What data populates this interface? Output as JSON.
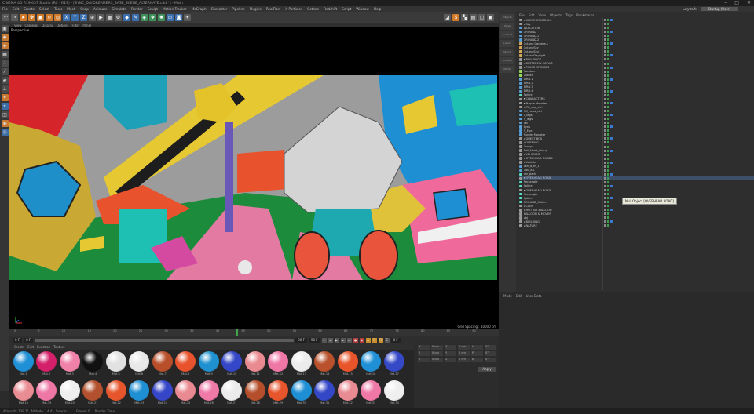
{
  "window": {
    "title": "CINEMA 4D R19.037 Studio (RC - R19) - [SYNC_DAYDREAMERS_BASE_SCENE_ALTERNATE.c4d *] - Main",
    "controls": [
      "–",
      "□",
      "✕"
    ]
  },
  "menus": [
    "File",
    "Edit",
    "Create",
    "Select",
    "Tools",
    "Mesh",
    "Snap",
    "Animate",
    "Simulate",
    "Render",
    "Sculpt",
    "Motion Tracker",
    "MoGraph",
    "Character",
    "Pipeline",
    "Plugins",
    "RealFlow",
    "X-Particles",
    "Octane",
    "Redshift",
    "Script",
    "Window",
    "Help"
  ],
  "layout": {
    "label": "Layout:",
    "value": "Startup (User)"
  },
  "viewport": {
    "menu": [
      "View",
      "Cameras",
      "Display",
      "Options",
      "Filter",
      "Panel"
    ],
    "name": "Perspective",
    "grid_spacing": "Grid Spacing : 10000 cm"
  },
  "timeline": {
    "ticks": [
      "0",
      "5",
      "10",
      "15",
      "20",
      "25",
      "30",
      "35",
      "40",
      "45",
      "50",
      "55",
      "60",
      "65",
      "70",
      "75",
      "80",
      "85",
      "90"
    ],
    "current_frame": "0 F",
    "start": "0 F",
    "end": "90 F",
    "end2": "90 F",
    "end_frame": "0 F"
  },
  "materials": {
    "menu": [
      "Create",
      "Edit",
      "Function",
      "Texture"
    ],
    "items": [
      {
        "label": "Mat.1",
        "color": "#1f8fd6"
      },
      {
        "label": "Mat.2",
        "color": "#d41f6a"
      },
      {
        "label": "Mat.3",
        "color": "#f081a8"
      },
      {
        "label": "Mat.4",
        "color": "#111111"
      },
      {
        "label": "Mat.5",
        "color": "#e2e2e2"
      },
      {
        "label": "Mat.6",
        "color": "#e8e8e8"
      },
      {
        "label": "Mat.7",
        "color": "#b84e2a"
      },
      {
        "label": "Mat.8",
        "color": "#e8522c"
      },
      {
        "label": "Mat.9",
        "color": "#1f91d0"
      },
      {
        "label": "Mat.10",
        "color": "#3447c8"
      },
      {
        "label": "Mat.11",
        "color": "#e88a90"
      },
      {
        "label": "Mat.12",
        "color": "#ef77a6"
      },
      {
        "label": "Mat.13",
        "color": "#ececec"
      },
      {
        "label": "Mat.14",
        "color": "#b8512c"
      },
      {
        "label": "Mat.15",
        "color": "#e8552a"
      },
      {
        "label": "Mat.16",
        "color": "#1f90d6"
      },
      {
        "label": "Mat.17",
        "color": "#3548c6"
      },
      {
        "label": "Mat.18",
        "color": "#e98c94"
      },
      {
        "label": "Mat.19",
        "color": "#ee77a6"
      },
      {
        "label": "Mat.20",
        "color": "#eeeeee"
      },
      {
        "label": "Mat.21",
        "color": "#b3512e"
      },
      {
        "label": "Mat.22",
        "color": "#e6552b"
      },
      {
        "label": "Mat.23",
        "color": "#1f8fd3"
      },
      {
        "label": "Mat.24",
        "color": "#3646c8"
      },
      {
        "label": "Mat.25",
        "color": "#e98a92"
      },
      {
        "label": "Mat.26",
        "color": "#ef7aa8"
      },
      {
        "label": "Mat.27",
        "color": "#ebebeb"
      },
      {
        "label": "Mat.28",
        "color": "#b54f2b"
      },
      {
        "label": "Mat.29",
        "color": "#e6552c"
      },
      {
        "label": "Mat.30",
        "color": "#1f8fd5"
      },
      {
        "label": "Mat.31",
        "color": "#3447c7"
      },
      {
        "label": "Mat.32",
        "color": "#e98b93"
      },
      {
        "label": "Mat.33",
        "color": "#ef78a7"
      },
      {
        "label": "Mat.34",
        "color": "#efefef"
      }
    ]
  },
  "attributes_mini": {
    "rows": [
      [
        "X",
        "0 cm",
        "X",
        "0 cm",
        "H",
        "0°"
      ],
      [
        "Y",
        "0 cm",
        "Y",
        "0 cm",
        "P",
        "0°"
      ],
      [
        "Z",
        "0 cm",
        "Z",
        "0 cm",
        "B",
        "0°"
      ]
    ],
    "apply": "Apply"
  },
  "status": [
    "Azimuth: 138.2°, Altitude: 14.4°, Swarm: ...",
    "Frame: 0",
    "Render Time: ..."
  ],
  "object_manager": {
    "menu": [
      "File",
      "Edit",
      "View",
      "Objects",
      "Tags",
      "Bookmarks"
    ],
    "side_tabs": [
      "Objects",
      "Takes",
      "Content",
      "Layers",
      "Struct.",
      "Browser",
      "Attribs"
    ],
    "tooltip": "Null Object [OVERHEAD ROAD]",
    "rows": [
      {
        "name": "▾ SCENE CONTROLS",
        "c": "#9a9a9a"
      },
      {
        "name": "  ▾ Sky",
        "c": "#9a9a9a"
      },
      {
        "name": "    INDICATION",
        "c": "#5aa0d8"
      },
      {
        "name": "    GROUND",
        "c": "#5aa0d8"
      },
      {
        "name": "    GROUND.1",
        "c": "#5aa0d8"
      },
      {
        "name": "    GROUND.2",
        "c": "#5aa0d8"
      },
      {
        "name": "    Octane Camera.1",
        "c": "#d8a85a"
      },
      {
        "name": "    OctaneSky",
        "c": "#d8a85a"
      },
      {
        "name": "    OctaneSky.1",
        "c": "#d8a85a"
      },
      {
        "name": "    OctaneDaylight",
        "c": "#d8a85a"
      },
      {
        "name": "▾ BUILDINGS",
        "c": "#9a9a9a"
      },
      {
        "name": "  ▸ BUTTERFLY GROUP",
        "c": "#9a9a9a"
      },
      {
        "name": "  ▾ FLOCK OF BIRDS",
        "c": "#9a9a9a"
      },
      {
        "name": "    Random",
        "c": "#9ad85a"
      },
      {
        "name": "    Cloner",
        "c": "#9ad85a"
      },
      {
        "name": "      BIRD.1",
        "c": "#5aa0d8"
      },
      {
        "name": "      BIRD.2",
        "c": "#5aa0d8"
      },
      {
        "name": "      BIRD.3",
        "c": "#5aa0d8"
      },
      {
        "name": "      BIRD.4",
        "c": "#5aa0d8"
      },
      {
        "name": "    Spline",
        "c": "#5ad8c0"
      },
      {
        "name": "▾ CHARACTERS",
        "c": "#9a9a9a"
      },
      {
        "name": "  ▾ Purple Monster",
        "c": "#9a9a9a"
      },
      {
        "name": "    ▾ Pill_cap_ctrl",
        "c": "#9a9a9a"
      },
      {
        "name": "      Pill_head_ctrl",
        "c": "#5aa0d8"
      },
      {
        "name": "      L_legs",
        "c": "#5aa0d8"
      },
      {
        "name": "      R_legs",
        "c": "#5aa0d8"
      },
      {
        "name": "      Tail",
        "c": "#5aa0d8"
      },
      {
        "name": "    Eyes",
        "c": "#5aa0d8"
      },
      {
        "name": "    R_Eye",
        "c": "#5aa0d8"
      },
      {
        "name": "    Purple_Monster",
        "c": "#5aa0d8"
      },
      {
        "name": "  ▸ GUEST BOX",
        "c": "#9a9a9a"
      },
      {
        "name": "    HOVERING",
        "c": "#9a9a9a"
      },
      {
        "name": "  Groups",
        "c": "#9a9a9a"
      },
      {
        "name": "  Ball_Head_Group",
        "c": "#9a9a9a"
      },
      {
        "name": "▾ VEHICLES",
        "c": "#9a9a9a"
      },
      {
        "name": "  ▾ OVERHEAD ROADS",
        "c": "#9a9a9a"
      },
      {
        "name": "    ▾ Vehicle",
        "c": "#9a9a9a"
      },
      {
        "name": "      Veh_a_m_1",
        "c": "#5aa0d8"
      },
      {
        "name": "      Cab_a.1",
        "c": "#5aa0d8"
      },
      {
        "name": "    car_path",
        "c": "#5ad8c0"
      },
      {
        "name": "  ▾ OVERHEAD ROAD",
        "c": "#9a9a9a",
        "sel": true
      },
      {
        "name": "      Rectangle",
        "c": "#5ad8c0"
      },
      {
        "name": "      Spline",
        "c": "#5ad8c0"
      },
      {
        "name": "  ▾ OVERHEAD ROAD",
        "c": "#9a9a9a"
      },
      {
        "name": "      Rectangle",
        "c": "#5ad8c0"
      },
      {
        "name": "      Spline",
        "c": "#5ad8c0"
      },
      {
        "name": "    GROUND_Spline",
        "c": "#5ad8c0"
      },
      {
        "name": "  ▸ CARS",
        "c": "#9a9a9a"
      },
      {
        "name": "  ▸ HOT AIR BALLOON",
        "c": "#9a9a9a"
      },
      {
        "name": "    BALLOON & MOVER",
        "c": "#9a9a9a"
      },
      {
        "name": "    obj",
        "c": "#9a9a9a"
      },
      {
        "name": "▸ BUILDING",
        "c": "#9a9a9a"
      },
      {
        "name": "▸ NATURE",
        "c": "#9a9a9a"
      }
    ]
  },
  "attribute_manager": {
    "menu": [
      "Mode",
      "Edit",
      "User Data"
    ]
  }
}
